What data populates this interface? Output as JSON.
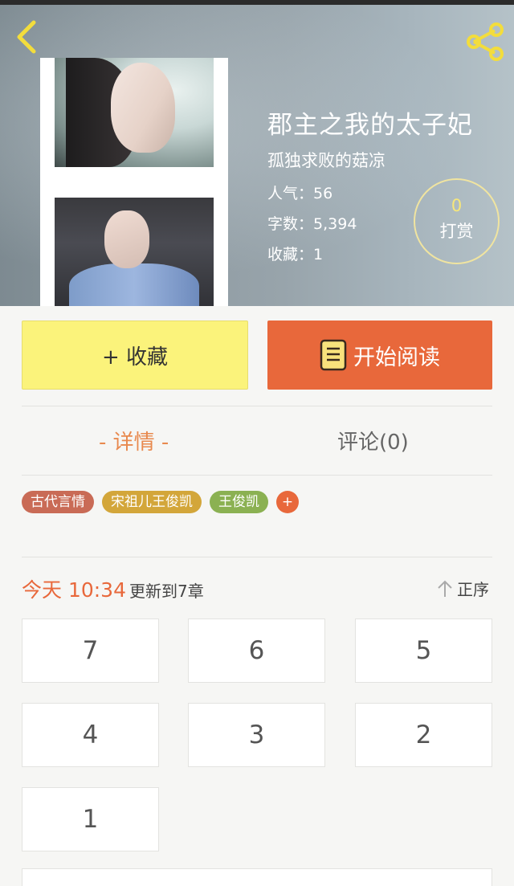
{
  "book": {
    "title": "郡主之我的太子妃",
    "author": "孤独求败的菇凉",
    "stats": [
      {
        "label": "人气：",
        "value": "56"
      },
      {
        "label": "字数：",
        "value": "5,394"
      },
      {
        "label": "收藏：",
        "value": "1"
      }
    ]
  },
  "reward": {
    "count": "0",
    "label": "打赏"
  },
  "actions": {
    "collect_label": "+ 收藏",
    "read_label": "开始阅读"
  },
  "tabs": {
    "detail": "- 详情 -",
    "comments": "评论(0)"
  },
  "tags": [
    {
      "label": "古代言情",
      "color": "#c96b56"
    },
    {
      "label": "宋祖儿王俊凯",
      "color": "#d3a63a"
    },
    {
      "label": "王俊凯",
      "color": "#8bb152"
    }
  ],
  "add_tag_label": "+",
  "update": {
    "today": "今天 10:34",
    "info": "更新到7章"
  },
  "sort_label": "正序",
  "chapters": [
    "7",
    "6",
    "5",
    "4",
    "3",
    "2",
    "1"
  ],
  "colors": {
    "accent_orange": "#e8683b",
    "collect_yellow": "#fbf37b",
    "tab_active": "#e8894e"
  }
}
